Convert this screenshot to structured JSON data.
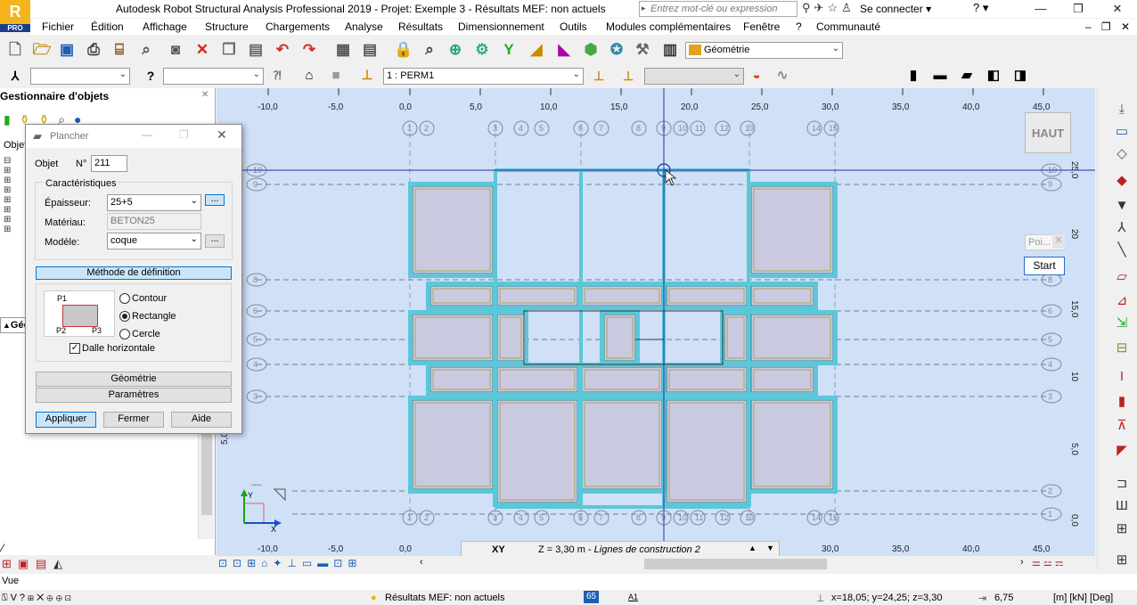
{
  "app": {
    "logo": "R",
    "logo_sub": "PRO",
    "title": "Autodesk Robot Structural Analysis Professional 2019 - Projet: Exemple 3 - Résultats MEF: non actuels",
    "search_placeholder": "Entrez mot-clé ou expression",
    "sign_in": "Se connecter",
    "help": "?",
    "window_buttons": [
      "—",
      "❐",
      "✕"
    ]
  },
  "menu": {
    "items": [
      "Fichier",
      "Édition",
      "Affichage",
      "Structure",
      "Chargements",
      "Analyse",
      "Résultats",
      "Dimensionnement",
      "Outils",
      "Modules complémentaires",
      "Fenêtre",
      "?",
      "Communauté"
    ],
    "mdi_controls": "– ❐ ✕"
  },
  "toolbar1": {
    "layout_dropdown": "Géométrie"
  },
  "toolbar2": {
    "load_case": "1 : PERM1"
  },
  "object_manager": {
    "title": "Gestionnaire d'objets",
    "objects_label": "Objet",
    "geo_tab": "Géon"
  },
  "dialog": {
    "title": "Plancher",
    "object_label": "Objet",
    "number_label": "N°",
    "number_value": "211",
    "characteristics_label": "Caractéristiques",
    "thickness_label": "Épaisseur:",
    "thickness_value": "25+5",
    "material_label": "Matériau:",
    "material_value": "BETON25",
    "model_label": "Modèle:",
    "model_value": "coque",
    "browse": "...",
    "method_button": "Méthode de définition",
    "method_options": [
      "Contour",
      "Rectangle",
      "Cercle"
    ],
    "method_selected": "Rectangle",
    "points": [
      "P1",
      "P2",
      "P3"
    ],
    "horizontal_slab": "Dalle horizontale",
    "geometry_button": "Géométrie",
    "parameters_button": "Paramètres",
    "apply": "Appliquer",
    "close": "Fermer",
    "help": "Aide"
  },
  "viewport": {
    "view_label": "HAUT",
    "poi_label": "Poi...",
    "start": "Start",
    "x_ruler": [
      "-10,0",
      "-5,0",
      "0,0",
      "5,0",
      "10,0",
      "15,0",
      "20,0",
      "25,0",
      "30,0",
      "35,0",
      "40,0",
      "45,0"
    ],
    "x_ruler_bottom": [
      "-10,0",
      "-5,0",
      "0,0",
      "30,0",
      "35,0",
      "40,0",
      "45,0"
    ],
    "y_ruler": [
      "25,0",
      "20",
      "15,0",
      "10",
      "5,0",
      "0,0"
    ],
    "y_ruler_left": [
      "5,0",
      "0,0"
    ],
    "column_axes": [
      "1",
      "2",
      "3",
      "4",
      "5",
      "6",
      "7",
      "8",
      "9",
      "10",
      "11",
      "12",
      "13",
      "14",
      "15"
    ],
    "row_axes": [
      "10",
      "9",
      "8",
      "6",
      "5",
      "4",
      "3",
      "2",
      "1"
    ],
    "plane": "XY",
    "level_info": "Z = 3,30 m - Lignes de construction 2",
    "level_info_prefix": "Z = 3,30 m - ",
    "level_info_italic": "Lignes de construction 2"
  },
  "statusbar": {
    "view": "Vue",
    "fem_status": "Résultats MEF: non actuels",
    "node_count": "65",
    "section": "A1",
    "coordinates": "x=18,05; y=24,25; z=3,30",
    "value": "6,75",
    "units": "[m] [kN] [Deg]"
  },
  "colors": {
    "background": "#cfe0f7",
    "beam": "#5ac8d8",
    "beam_edge": "#1f8a9c",
    "slab_panel": "#c9c9df",
    "accent": "#0078d7"
  }
}
